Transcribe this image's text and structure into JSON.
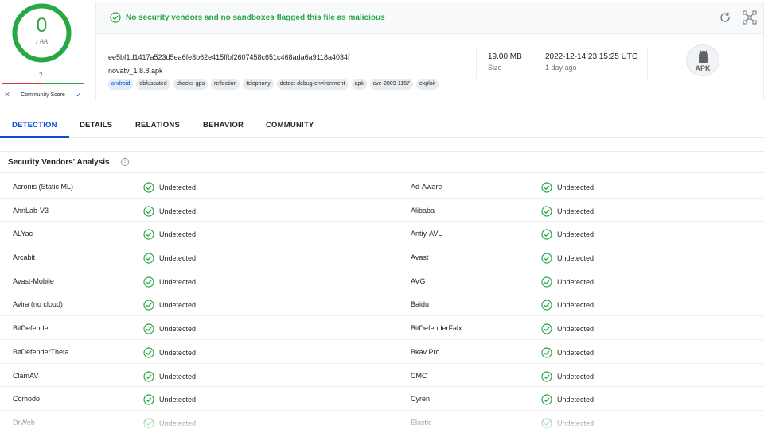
{
  "score": {
    "detections": "0",
    "total": "/ 66",
    "community_unknown": "?",
    "community_label": "Community Score",
    "community_down_icon": "close-icon",
    "community_up_icon": "check-icon",
    "ring_color": "#28a745"
  },
  "file": {
    "status_message": "No security vendors and no sandboxes flagged this file as malicious",
    "hash": "ee5bf1d1417a523d5ea6fe3b62e415ffbf2607458c651c468ada6a9118a4034f",
    "name": "novatv_1.8.8.apk",
    "tags": [
      "android",
      "obfuscated",
      "checks-gps",
      "reflection",
      "telephony",
      "detect-debug-environment",
      "apk",
      "cve-2009-1157",
      "exploit"
    ],
    "size_value": "19.00 MB",
    "size_label": "Size",
    "date_value": "2022-12-14 23:15:25 UTC",
    "date_label": "1 day ago",
    "type_badge": "APK",
    "reanalyze_icon": "refresh-icon",
    "similar_icon": "graph-icon"
  },
  "tabs": [
    {
      "label": "DETECTION",
      "active": true
    },
    {
      "label": "DETAILS",
      "active": false
    },
    {
      "label": "RELATIONS",
      "active": false
    },
    {
      "label": "BEHAVIOR",
      "active": false
    },
    {
      "label": "COMMUNITY",
      "active": false
    }
  ],
  "section": {
    "title": "Security Vendors' Analysis",
    "info_icon": "info-icon"
  },
  "colors": {
    "accent": "#0b4dda",
    "clean": "#28a745",
    "malicious": "#dc3545"
  },
  "vendors": [
    {
      "left": {
        "name": "Acronis (Static ML)",
        "result": "Undetected"
      },
      "right": {
        "name": "Ad-Aware",
        "result": "Undetected"
      }
    },
    {
      "left": {
        "name": "AhnLab-V3",
        "result": "Undetected"
      },
      "right": {
        "name": "Alibaba",
        "result": "Undetected"
      }
    },
    {
      "left": {
        "name": "ALYac",
        "result": "Undetected"
      },
      "right": {
        "name": "Antiy-AVL",
        "result": "Undetected"
      }
    },
    {
      "left": {
        "name": "Arcabit",
        "result": "Undetected"
      },
      "right": {
        "name": "Avast",
        "result": "Undetected"
      }
    },
    {
      "left": {
        "name": "Avast-Mobile",
        "result": "Undetected"
      },
      "right": {
        "name": "AVG",
        "result": "Undetected"
      }
    },
    {
      "left": {
        "name": "Avira (no cloud)",
        "result": "Undetected"
      },
      "right": {
        "name": "Baidu",
        "result": "Undetected"
      }
    },
    {
      "left": {
        "name": "BitDefender",
        "result": "Undetected"
      },
      "right": {
        "name": "BitDefenderFalx",
        "result": "Undetected"
      }
    },
    {
      "left": {
        "name": "BitDefenderTheta",
        "result": "Undetected"
      },
      "right": {
        "name": "Bkav Pro",
        "result": "Undetected"
      }
    },
    {
      "left": {
        "name": "ClamAV",
        "result": "Undetected"
      },
      "right": {
        "name": "CMC",
        "result": "Undetected"
      }
    },
    {
      "left": {
        "name": "Comodo",
        "result": "Undetected"
      },
      "right": {
        "name": "Cyren",
        "result": "Undetected"
      }
    },
    {
      "left": {
        "name": "DrWeb",
        "result": "Undetected"
      },
      "right": {
        "name": "Elastic",
        "result": "Undetected"
      }
    }
  ]
}
